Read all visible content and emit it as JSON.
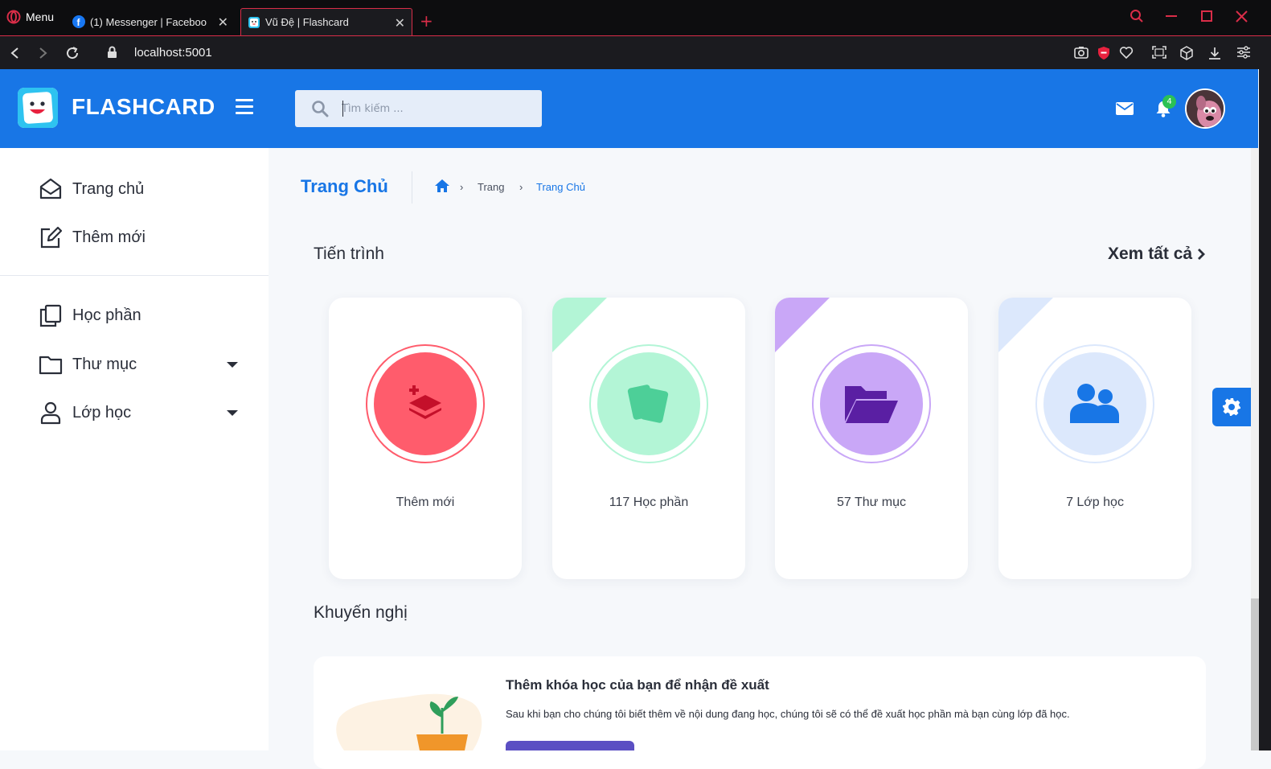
{
  "browser": {
    "menu_label": "Menu",
    "tabs": [
      {
        "title": "(1) Messenger | Faceboo"
      },
      {
        "title": "Vũ Đệ | Flashcard"
      }
    ],
    "url": "localhost:5001"
  },
  "header": {
    "brand": "FLASHCARD",
    "search_placeholder": "Tìm kiếm ...",
    "notification_count": "4"
  },
  "sidebar": {
    "items": [
      {
        "label": "Trang chủ"
      },
      {
        "label": "Thêm mới"
      },
      {
        "label": "Học phần"
      },
      {
        "label": "Thư mục"
      },
      {
        "label": "Lớp học"
      }
    ]
  },
  "main": {
    "page_title": "Trang Chủ",
    "breadcrumb": [
      "Trang",
      "Trang Chủ"
    ],
    "progress_title": "Tiến trình",
    "see_all": "Xem tất cả",
    "cards": [
      {
        "label": "Thêm mới"
      },
      {
        "label": "117 Học phần"
      },
      {
        "label": "57 Thư mục"
      },
      {
        "label": "7 Lớp học"
      }
    ],
    "recommend_title": "Khuyến nghị",
    "recommend": {
      "title": "Thêm khóa học của bạn để nhận đề xuất",
      "description": "Sau khi bạn cho chúng tôi biết thêm về nội dung đang học, chúng tôi sẽ có thể đề xuất học phần mà bạn cùng lớp đã học."
    }
  },
  "colors": {
    "primary": "#1876e6",
    "add_card": "#ff5c6c",
    "study_card": "#b3f5d6",
    "folder_card": "#c9a7f7",
    "class_card": "#dce8fc"
  }
}
